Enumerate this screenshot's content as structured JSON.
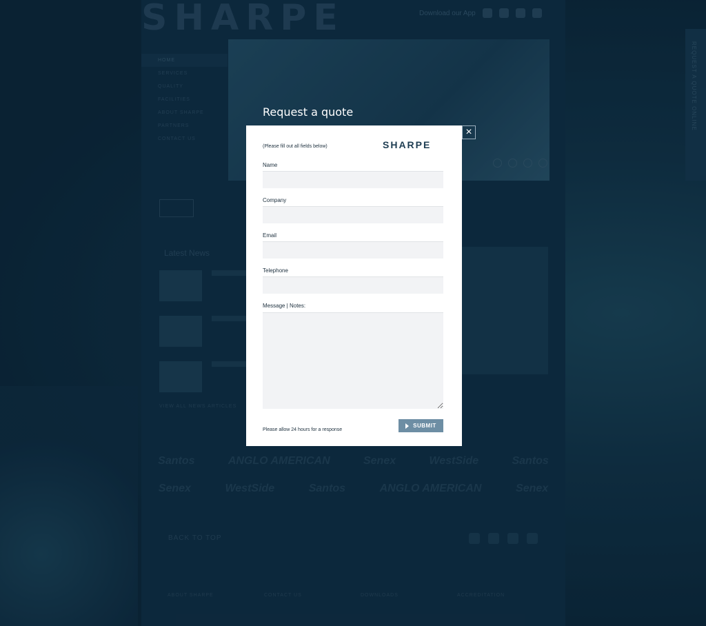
{
  "header": {
    "logo": "SHARPE",
    "download_app": "Download our App"
  },
  "side_tab": {
    "label": "REQUEST A QUOTE ONLINE"
  },
  "nav": {
    "items": [
      "HOME",
      "SERVICES",
      "QUALITY",
      "FACILITIES",
      "ABOUT SHARPE",
      "PARTNERS",
      "CONTACT US"
    ]
  },
  "news": {
    "title": "Latest News",
    "view_all": "VIEW ALL NEWS ARTICLES"
  },
  "partners": {
    "row1": [
      "Santos",
      "ANGLO AMERICAN",
      "Senex",
      "WestSide",
      "Santos"
    ],
    "row2": [
      "Senex",
      "WestSide",
      "Santos",
      "ANGLO AMERICAN",
      "Senex"
    ]
  },
  "footer": {
    "back_to_top": "BACK TO TOP",
    "columns": [
      "ABOUT SHARPE",
      "CONTACT US",
      "DOWNLOADS",
      "ACCREDITATION"
    ]
  },
  "modal": {
    "title": "Request a quote",
    "close": "×",
    "hint": "(Please fill out all fields below)",
    "brand": "SHARPE",
    "fields": {
      "name": "Name",
      "company": "Company",
      "email": "Email",
      "telephone": "Telephone",
      "message": "Message | Notes:"
    },
    "note": "Please allow 24 hours for a response",
    "submit": "SUBMIT"
  }
}
